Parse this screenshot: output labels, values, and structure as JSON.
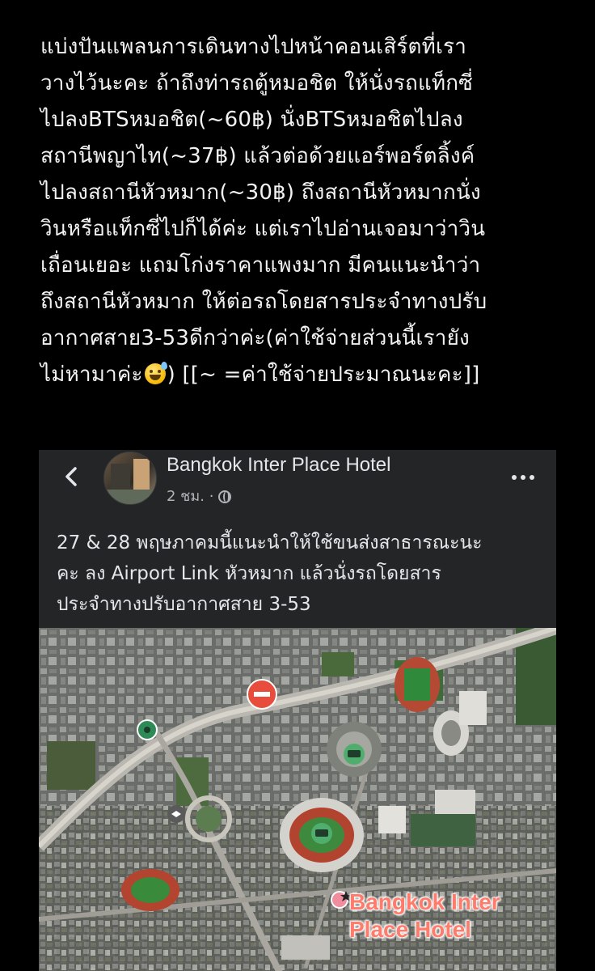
{
  "tweet": {
    "lines": [
      "แบ่งปันแพลนการเดินทางไปหน้าคอนเสิร์ตที่เรา",
      "วางไว้นะคะ ถ้าถึงท่ารถตู้หมอชิต ให้นั่งรถแท็กซี่",
      "ไปลงBTSหมอชิต(~60฿) นั่งBTSหมอชิตไปลง",
      "สถานีพญาไท(~37฿) แล้วต่อด้วยแอร์พอร์ตลิ้งค์",
      "ไปลงสถานีหัวหมาก(~30฿) ถึงสถานีหัวหมากนั่ง",
      "วินหรือแท็กซี่ไปก็ได้ค่ะ แต่เราไปอ่านเจอมาว่าวิน",
      "เถื่อนเยอะ แถมโก่งราคาแพงมาก มีคนแนะนำว่า",
      "ถึงสถานีหัวหมาก ให้ต่อรถโดยสารประจำทางปรับ",
      "อากาศสาย3-53ดีกว่าค่ะ(ค่าใช้จ่ายส่วนนี้เรายัง"
    ],
    "last_line_before_emoji": "ไม่หามาค่ะ",
    "emoji": "sweat-smile-emoji",
    "last_line_after_emoji": ") [[~ =ค่าใช้จ่ายประมาณนะคะ]]"
  },
  "post": {
    "page_name": "Bangkok Inter Place Hotel",
    "time": "2 ชม.",
    "separator": "·",
    "lines": [
      "27 & 28 พฤษภาคมนี้แนะนำให้ใช้ขนส่งสาธารณะนะ",
      "คะ ลง Airport Link หัวหมาก แล้วนั่งรถโดยสาร",
      "ประจำทางปรับอากาศสาย 3-53"
    ],
    "back_icon": "chevron-left-icon",
    "more_icon": "more-horizontal-icon",
    "privacy_icon": "globe-icon"
  },
  "map": {
    "label_lines": [
      "Bangkok Inter",
      "Place Hotel"
    ],
    "label_color": "#ff7b6b"
  }
}
